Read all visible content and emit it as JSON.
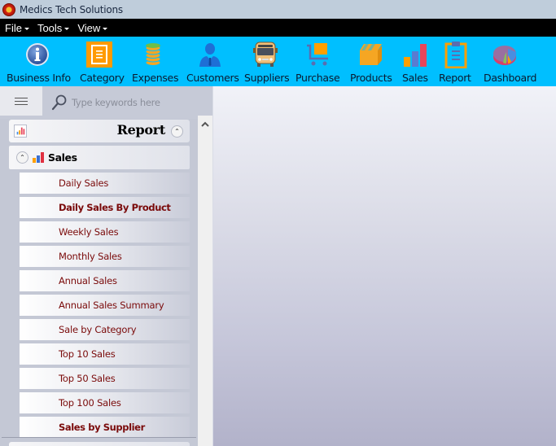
{
  "window": {
    "title": "Medics Tech Solutions",
    "logo_icon": "app-logo-icon"
  },
  "menubar": {
    "items": [
      {
        "label": "File"
      },
      {
        "label": "Tools"
      },
      {
        "label": "View"
      }
    ]
  },
  "toolbar": {
    "items": [
      {
        "label": "Business Info",
        "icon": "info-icon"
      },
      {
        "label": "Category",
        "icon": "category-icon"
      },
      {
        "label": "Expenses",
        "icon": "coins-icon"
      },
      {
        "label": "Customers",
        "icon": "customer-icon"
      },
      {
        "label": "Suppliers",
        "icon": "bus-icon"
      },
      {
        "label": "Purchase",
        "icon": "cart-icon"
      },
      {
        "label": "Products",
        "icon": "box-icon"
      },
      {
        "label": "Sales",
        "icon": "bar-chart-icon"
      },
      {
        "label": "Report",
        "icon": "clipboard-icon"
      },
      {
        "label": "Dashboard",
        "icon": "pie-chart-icon"
      }
    ],
    "background": "#00bfff"
  },
  "sidebar": {
    "search": {
      "placeholder": "Type keywords here",
      "value": ""
    },
    "group": {
      "title": "Report",
      "subgroup": {
        "title": "Sales",
        "items": [
          {
            "label": "Daily Sales",
            "bold": false
          },
          {
            "label": "Daily Sales By Product",
            "bold": true
          },
          {
            "label": "Weekly Sales",
            "bold": false
          },
          {
            "label": "Monthly Sales",
            "bold": false
          },
          {
            "label": "Annual Sales",
            "bold": false
          },
          {
            "label": "Annual Sales Summary",
            "bold": false
          },
          {
            "label": "Sale by Category",
            "bold": false
          },
          {
            "label": "Top 10 Sales",
            "bold": false
          },
          {
            "label": "Top 50 Sales",
            "bold": false
          },
          {
            "label": "Top 100 Sales",
            "bold": false
          },
          {
            "label": "Sales by Supplier",
            "bold": true
          }
        ]
      }
    },
    "link_color": "#7a0a0a"
  }
}
